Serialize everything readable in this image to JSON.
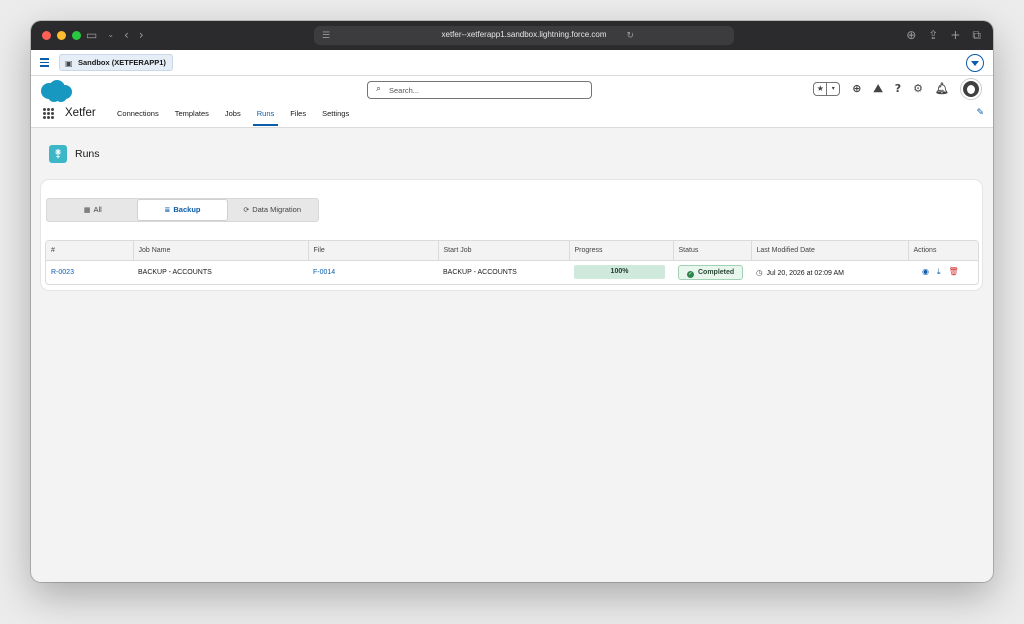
{
  "browser": {
    "url": "xetfer--xetferapp1.sandbox.lightning.force.com"
  },
  "sandbox": {
    "label": "Sandbox (XETFERAPP1)"
  },
  "header": {
    "search_placeholder": "Search...",
    "app_name": "Xetfer",
    "nav": [
      "Connections",
      "Templates",
      "Jobs",
      "Runs",
      "Files",
      "Settings"
    ],
    "active_nav": "Runs"
  },
  "page": {
    "title": "Runs"
  },
  "tabs": {
    "all": "All",
    "backup": "Backup",
    "migration": "Data Migration",
    "active": "Backup"
  },
  "table": {
    "columns": [
      "#",
      "Job Name",
      "File",
      "Start Job",
      "Progress",
      "Status",
      "Last Modified Date",
      "Actions"
    ],
    "rows": [
      {
        "id": "R-0023",
        "job_name": "BACKUP - ACCOUNTS",
        "file": "F-0014",
        "start_job": "BACKUP - ACCOUNTS",
        "progress": "100%",
        "status": "Completed",
        "modified": "Jul 20, 2026 at 02:09 AM"
      }
    ]
  },
  "colors": {
    "brand": "#0b5cab",
    "page_icon": "#3cb7c7",
    "success": "#2e844a",
    "danger": "#d32f2f"
  }
}
